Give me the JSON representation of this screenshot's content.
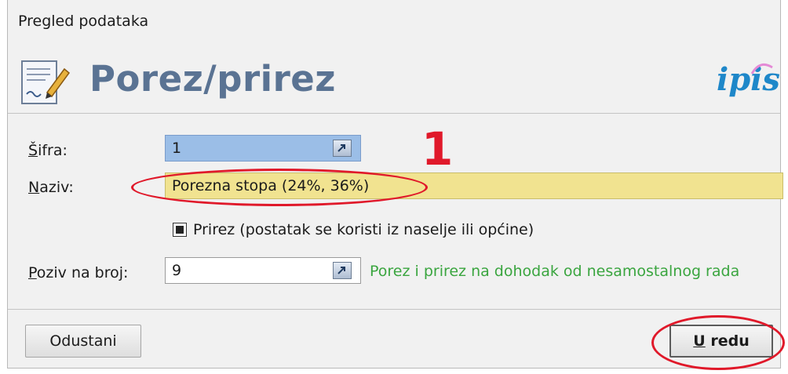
{
  "window": {
    "title": "Pregled podataka"
  },
  "header": {
    "title": "Porez/prirez",
    "logo_text": "ipis",
    "icon": "document-pen-icon"
  },
  "form": {
    "sifra": {
      "label_u": "Š",
      "label_rest": "ifra:",
      "value": "1"
    },
    "naziv": {
      "label_u": "N",
      "label_rest": "aziv:",
      "value": "Porezna stopa (24%, 36%)"
    },
    "prirez": {
      "label": "Prirez (postatak se koristi iz naselje ili općine)",
      "checked": true
    },
    "poziv": {
      "label_u": "P",
      "label_rest": "oziv na broj:",
      "value": "9",
      "description": "Porez i prirez na dohodak od nesamostalnog rada"
    }
  },
  "buttons": {
    "cancel": "Odustani",
    "ok_u": "U",
    "ok_rest": " redu"
  },
  "annotations": {
    "number": "1",
    "color": "#e0192a"
  },
  "colors": {
    "header_title": "#5a7393",
    "logo": "#1e87c9",
    "selected_field": "#9bbee7",
    "naziv_field": "#f1e390",
    "description": "#3aa53f"
  }
}
